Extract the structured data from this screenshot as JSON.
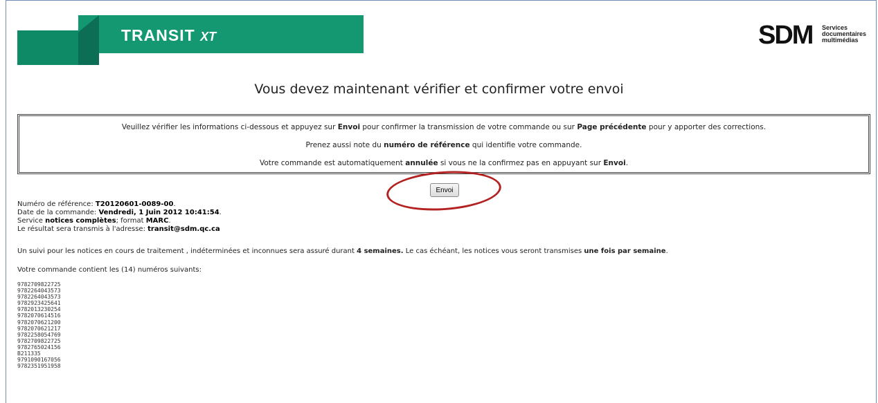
{
  "header": {
    "product_title": "TRANSIT",
    "product_suffix": "XT",
    "brand_mark": "SDM",
    "brand_lines": [
      "Services",
      "documentaires",
      "multimédias"
    ]
  },
  "headline": "Vous devez maintenant vérifier et confirmer votre envoi",
  "notice": {
    "line1_a": "Veuillez vérifier les informations ci-dessous et appuyez sur ",
    "line1_b": "Envoi",
    "line1_c": " pour confirmer la transmission de votre commande ou sur ",
    "line1_d": "Page précédente",
    "line1_e": " pour y apporter des corrections.",
    "line2_a": "Prenez aussi note du ",
    "line2_b": "numéro de référence",
    "line2_c": " qui identifie votre commande.",
    "line3_a": "Votre commande est automatiquement ",
    "line3_b": "annulée",
    "line3_c": " si vous ne la confirmez pas en appuyant sur ",
    "line3_d": "Envoi",
    "line3_e": "."
  },
  "submit_label": "Envoi",
  "order": {
    "ref_label": "Numéro de référence: ",
    "ref_value": "T20120601-0089-00",
    "ref_end": ".",
    "date_label": "Date de la commande: ",
    "date_value": "Vendredi, 1 Juin 2012 10:41:54",
    "date_end": ".",
    "service_label": "Service ",
    "service_value": "notices complètes",
    "format_label": "; format ",
    "format_value": "MARC",
    "format_end": ".",
    "email_label": "Le résultat sera transmis à l'adresse: ",
    "email_value": "transit@sdm.qc.ca"
  },
  "followup": {
    "a": "Un suivi pour les notices en cours de traitement , indéterminées et inconnues sera assuré durant ",
    "b": "4 semaines.",
    "c": "  Le cas échéant, les notices vous seront transmises ",
    "d": "une fois par semaine",
    "e": "."
  },
  "contains_text": "Votre commande contient les (14) numéros suivants:",
  "isbns": [
    "9782709822725",
    "9782264043573",
    "9782264043573",
    "9782923425641",
    "9782013230254",
    "9782070614516",
    "9782070621200",
    "9782070621217",
    "9782258054769",
    "9782709822725",
    "9782765024156",
    "B211335",
    "9791090167056",
    "9782351951958"
  ],
  "colors": {
    "banner_green": "#169a73",
    "ring_red": "#b42121",
    "frame_blue": "#6f8fb8"
  }
}
